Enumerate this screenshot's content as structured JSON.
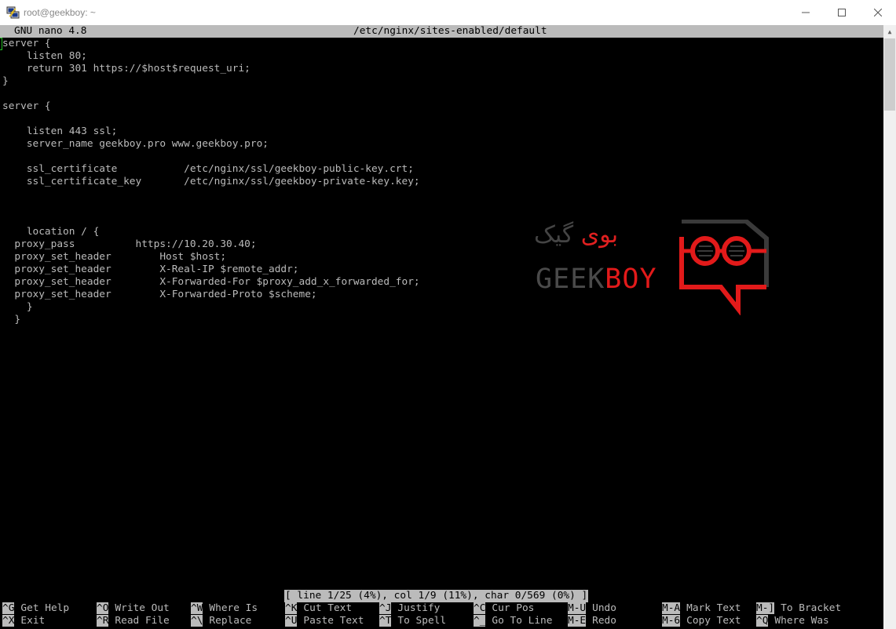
{
  "window": {
    "title": "root@geekboy: ~",
    "minimize_glyph": "—",
    "maximize_glyph": "☐",
    "close_glyph": "✕"
  },
  "nano": {
    "version": "GNU nano 4.8",
    "filename": "/etc/nginx/sites-enabled/default",
    "lines": [
      "server {",
      "    listen 80;",
      "    return 301 https://$host$request_uri;",
      "}",
      "",
      "server {",
      "",
      "    listen 443 ssl;",
      "    server_name geekboy.pro www.geekboy.pro;",
      "",
      "    ssl_certificate           /etc/nginx/ssl/geekboy-public-key.crt;",
      "    ssl_certificate_key       /etc/nginx/ssl/geekboy-private-key.key;",
      "",
      "",
      "",
      "    location / {",
      "  proxy_pass          https://10.20.30.40;",
      "  proxy_set_header        Host $host;",
      "  proxy_set_header        X-Real-IP $remote_addr;",
      "  proxy_set_header        X-Forwarded-For $proxy_add_x_forwarded_for;",
      "  proxy_set_header        X-Forwarded-Proto $scheme;",
      "    }",
      "  }"
    ],
    "status": "[ line 1/25 (4%), col 1/9 (11%), char 0/569 (0%) ]",
    "shortcuts_row1": [
      {
        "key": "^G",
        "label": "Get Help"
      },
      {
        "key": "^O",
        "label": "Write Out"
      },
      {
        "key": "^W",
        "label": "Where Is"
      },
      {
        "key": "^K",
        "label": "Cut Text"
      },
      {
        "key": "^J",
        "label": "Justify"
      },
      {
        "key": "^C",
        "label": "Cur Pos"
      },
      {
        "key": "M-U",
        "label": "Undo"
      },
      {
        "key": "M-A",
        "label": "Mark Text"
      },
      {
        "key": "M-]",
        "label": "To Bracket"
      }
    ],
    "shortcuts_row2": [
      {
        "key": "^X",
        "label": "Exit"
      },
      {
        "key": "^R",
        "label": "Read File"
      },
      {
        "key": "^\\",
        "label": "Replace"
      },
      {
        "key": "^U",
        "label": "Paste Text"
      },
      {
        "key": "^T",
        "label": "To Spell"
      },
      {
        "key": "^_",
        "label": "Go To Line"
      },
      {
        "key": "M-E",
        "label": "Redo"
      },
      {
        "key": "M-6",
        "label": "Copy Text"
      },
      {
        "key": "^Q",
        "label": "Where Was"
      }
    ]
  },
  "watermark": {
    "persian_part1": "بوی",
    "persian_part2": "گیک",
    "word_part1": "GEEK",
    "word_part2": "BOY",
    "color_red": "#e21a1a",
    "color_gray": "#4a4a4a"
  }
}
